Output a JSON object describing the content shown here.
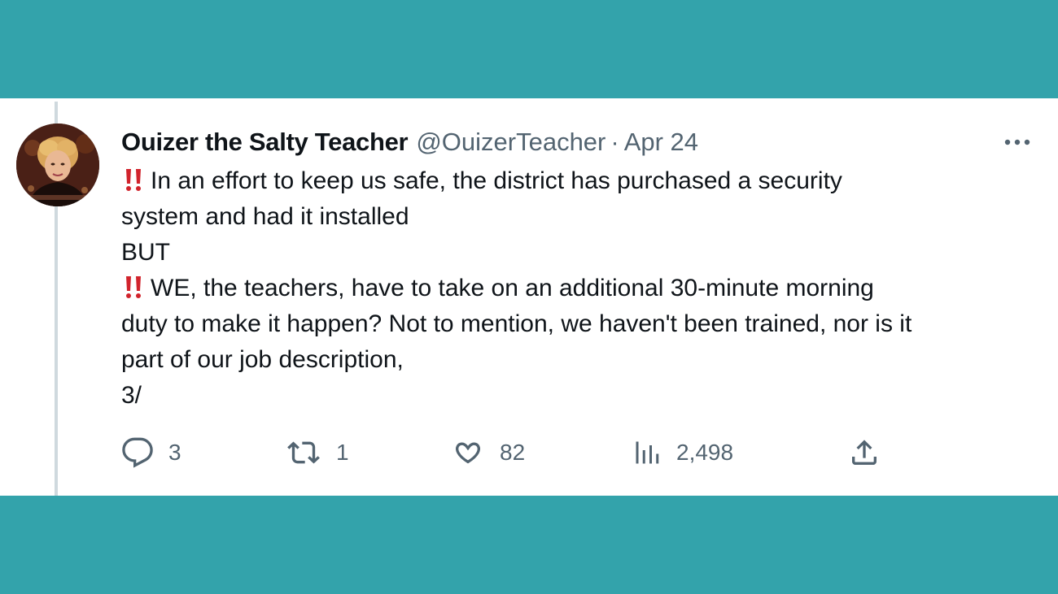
{
  "tweet": {
    "display_name": "Ouizer the Salty Teacher",
    "handle": "@OuizerTeacher",
    "separator": "·",
    "date": "Apr 24",
    "more_icon": "more-dots-icon",
    "avatar": "profile-photo",
    "lines": [
      "In an effort to keep us safe, the district has purchased a security",
      "system and had it installed",
      "BUT",
      "WE, the teachers, have to take on an additional 30-minute morning",
      "duty to make it happen? Not to mention, we haven't been trained, nor is it",
      "part of our job description,",
      "3/"
    ],
    "emoji": "double-exclamation-mark",
    "accent_color": "#d1232c"
  },
  "actions": {
    "replies": {
      "icon": "reply-icon",
      "count": "3"
    },
    "retweets": {
      "icon": "retweet-icon",
      "count": "1"
    },
    "likes": {
      "icon": "heart-icon",
      "count": "82"
    },
    "views": {
      "icon": "views-chart-icon",
      "count": "2,498"
    },
    "share": {
      "icon": "share-icon"
    }
  },
  "colors": {
    "background": "#33a3ab",
    "card": "#ffffff",
    "text": "#0f1419",
    "muted": "#536471",
    "thread_line": "#cfd9de"
  }
}
